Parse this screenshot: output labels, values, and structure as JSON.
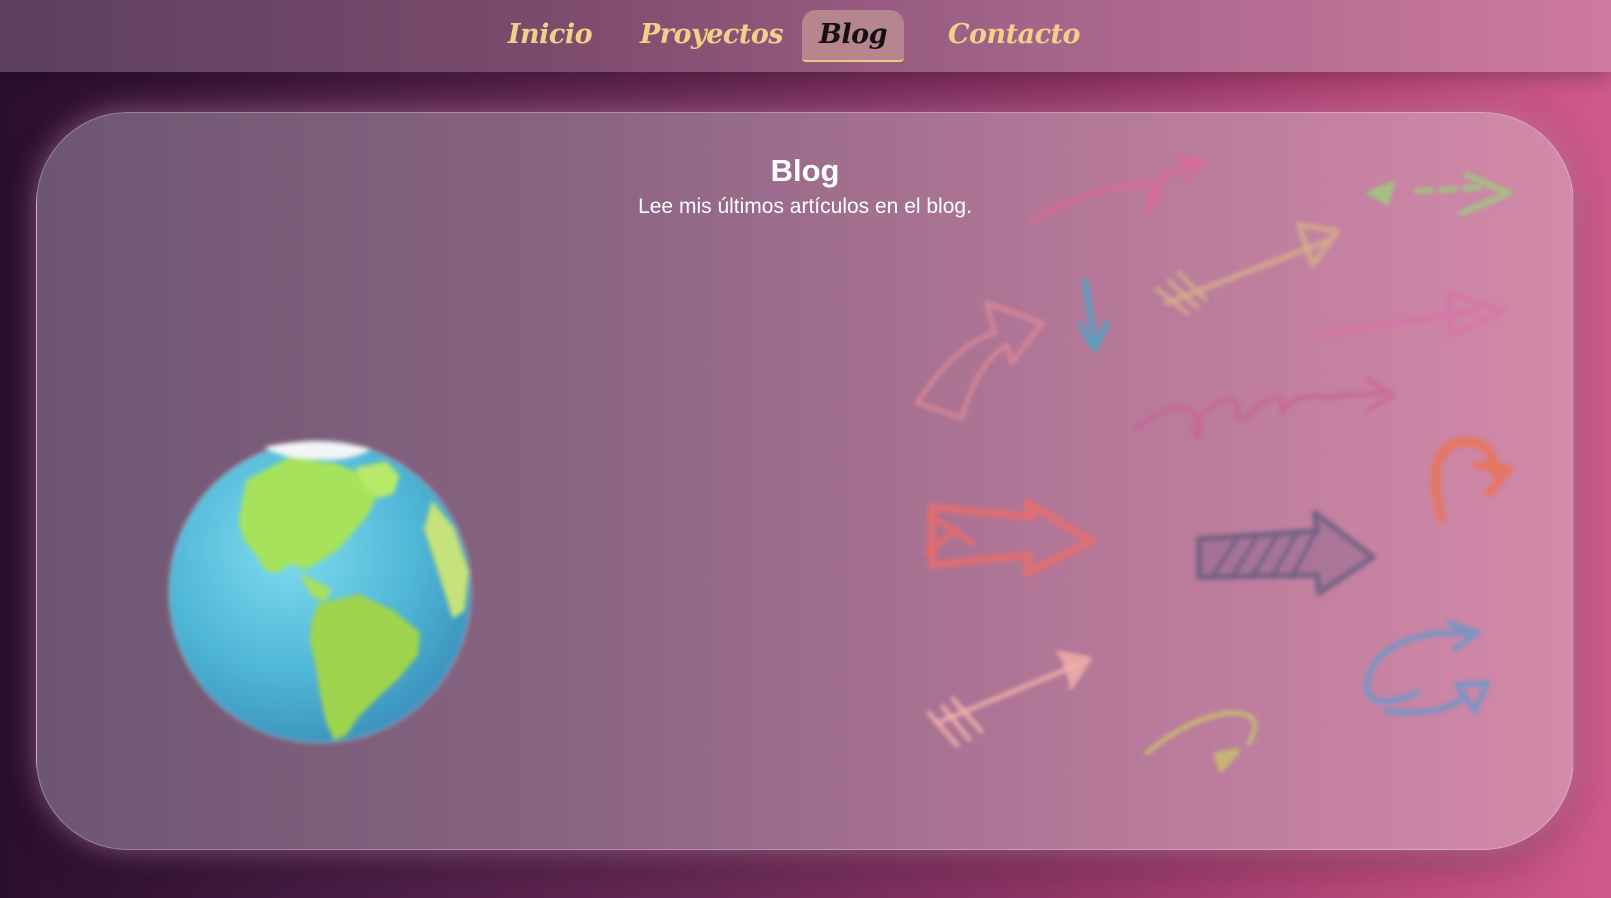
{
  "nav": {
    "items": [
      {
        "label": "Inicio",
        "active": false
      },
      {
        "label": "Proyectos",
        "active": false
      },
      {
        "label": "Blog",
        "active": true
      },
      {
        "label": "Contacto",
        "active": false
      }
    ]
  },
  "section": {
    "title": "Blog",
    "subtitle": "Lee mis últimos artículos en el blog."
  },
  "illustrations": {
    "globe_icon": "earth-globe-icon",
    "arrows_icon": "doodle-arrows-icon"
  },
  "colors": {
    "nav_text": "#f1d08a",
    "nav_active_bg": "#b68690",
    "nav_active_text": "#161014",
    "card_text": "#ffffff"
  }
}
